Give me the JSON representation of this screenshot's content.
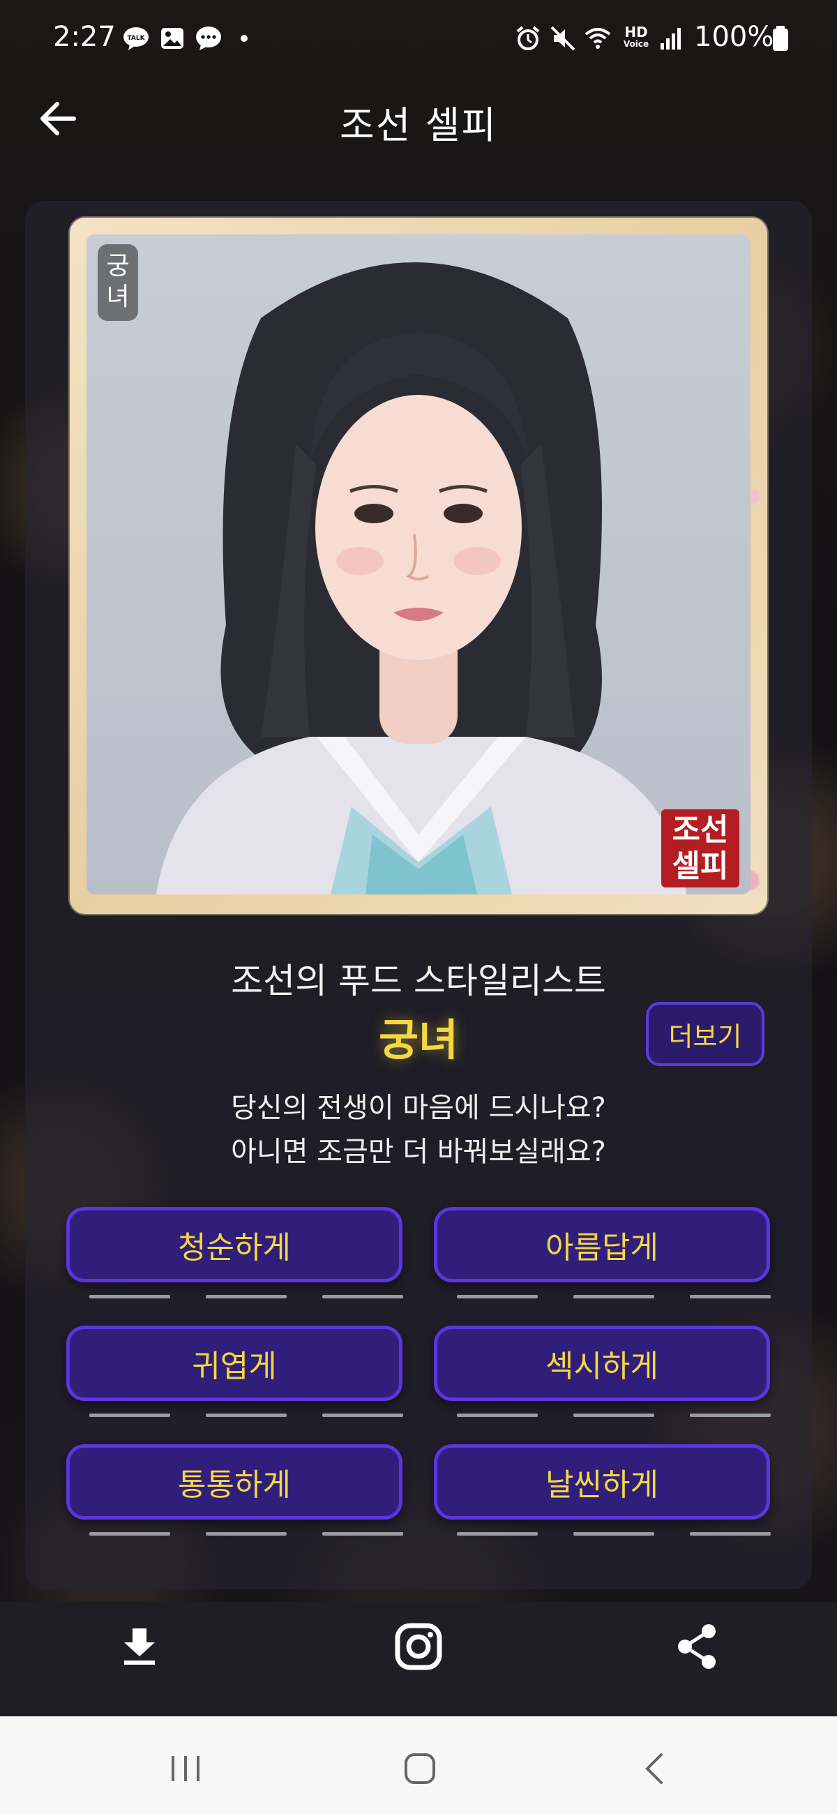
{
  "status_bar": {
    "time": "2:27",
    "battery": "100%",
    "icons": [
      "talk-icon",
      "gallery-icon",
      "message-icon",
      "dot-icon",
      "alarm-icon",
      "mute-icon",
      "wifi-icon",
      "hd-voice-icon",
      "signal-icon",
      "battery-icon"
    ],
    "hd_label_top": "HD",
    "hd_label_bottom": "Voice"
  },
  "header": {
    "title": "조선 셀피",
    "back_icon": "arrow-left-icon"
  },
  "portrait": {
    "rank_tag": "궁녀",
    "seal_line_1": "조선",
    "seal_line_2": "셀피"
  },
  "result": {
    "subtitle": "조선의 푸드 스타일리스트",
    "name": "궁녀",
    "more_label": "더보기",
    "prompt_line_1": "당신의 전생이 마음에 드시나요?",
    "prompt_line_2": "아니면 조금만 더 바꿔보실래요?"
  },
  "options": [
    {
      "label": "청순하게"
    },
    {
      "label": "아름답게"
    },
    {
      "label": "귀엽게"
    },
    {
      "label": "섹시하게"
    },
    {
      "label": "통통하게"
    },
    {
      "label": "날씬하게"
    }
  ],
  "bottom_actions": {
    "download_icon": "download-icon",
    "instagram_icon": "instagram-icon",
    "share_icon": "share-icon"
  },
  "nav": {
    "recents_icon": "recents-icon",
    "home_icon": "home-icon",
    "back_icon": "nav-back-icon"
  },
  "colors": {
    "accent_purple": "#5a35e0",
    "button_fill": "#2f1f7a",
    "highlight_yellow": "#f5d742",
    "seal_red": "#b41e22"
  }
}
